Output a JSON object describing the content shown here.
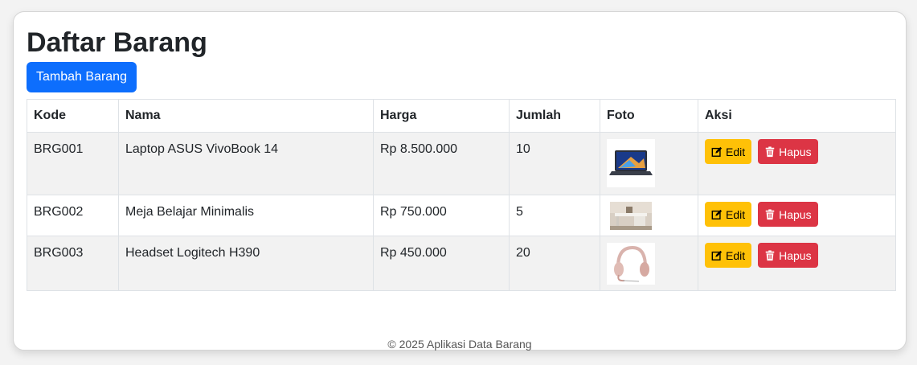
{
  "page": {
    "title": "Daftar Barang",
    "add_button": "Tambah Barang"
  },
  "table": {
    "headers": {
      "kode": "Kode",
      "nama": "Nama",
      "harga": "Harga",
      "jumlah": "Jumlah",
      "foto": "Foto",
      "aksi": "Aksi"
    },
    "rows": [
      {
        "kode": "BRG001",
        "nama": "Laptop ASUS VivoBook 14",
        "harga": "Rp 8.500.000",
        "jumlah": "10",
        "foto": "laptop-image"
      },
      {
        "kode": "BRG002",
        "nama": "Meja Belajar Minimalis",
        "harga": "Rp 750.000",
        "jumlah": "5",
        "foto": "desk-image"
      },
      {
        "kode": "BRG003",
        "nama": "Headset Logitech H390",
        "harga": "Rp 450.000",
        "jumlah": "20",
        "foto": "headset-image"
      }
    ],
    "edit_label": "Edit",
    "delete_label": "Hapus"
  },
  "footer": {
    "text": "© 2025 Aplikasi Data Barang"
  },
  "colors": {
    "primary": "#0d6efd",
    "warning": "#ffc107",
    "danger": "#dc3545"
  },
  "icons": {
    "edit": "pencil-square-icon",
    "delete": "trash-icon"
  }
}
